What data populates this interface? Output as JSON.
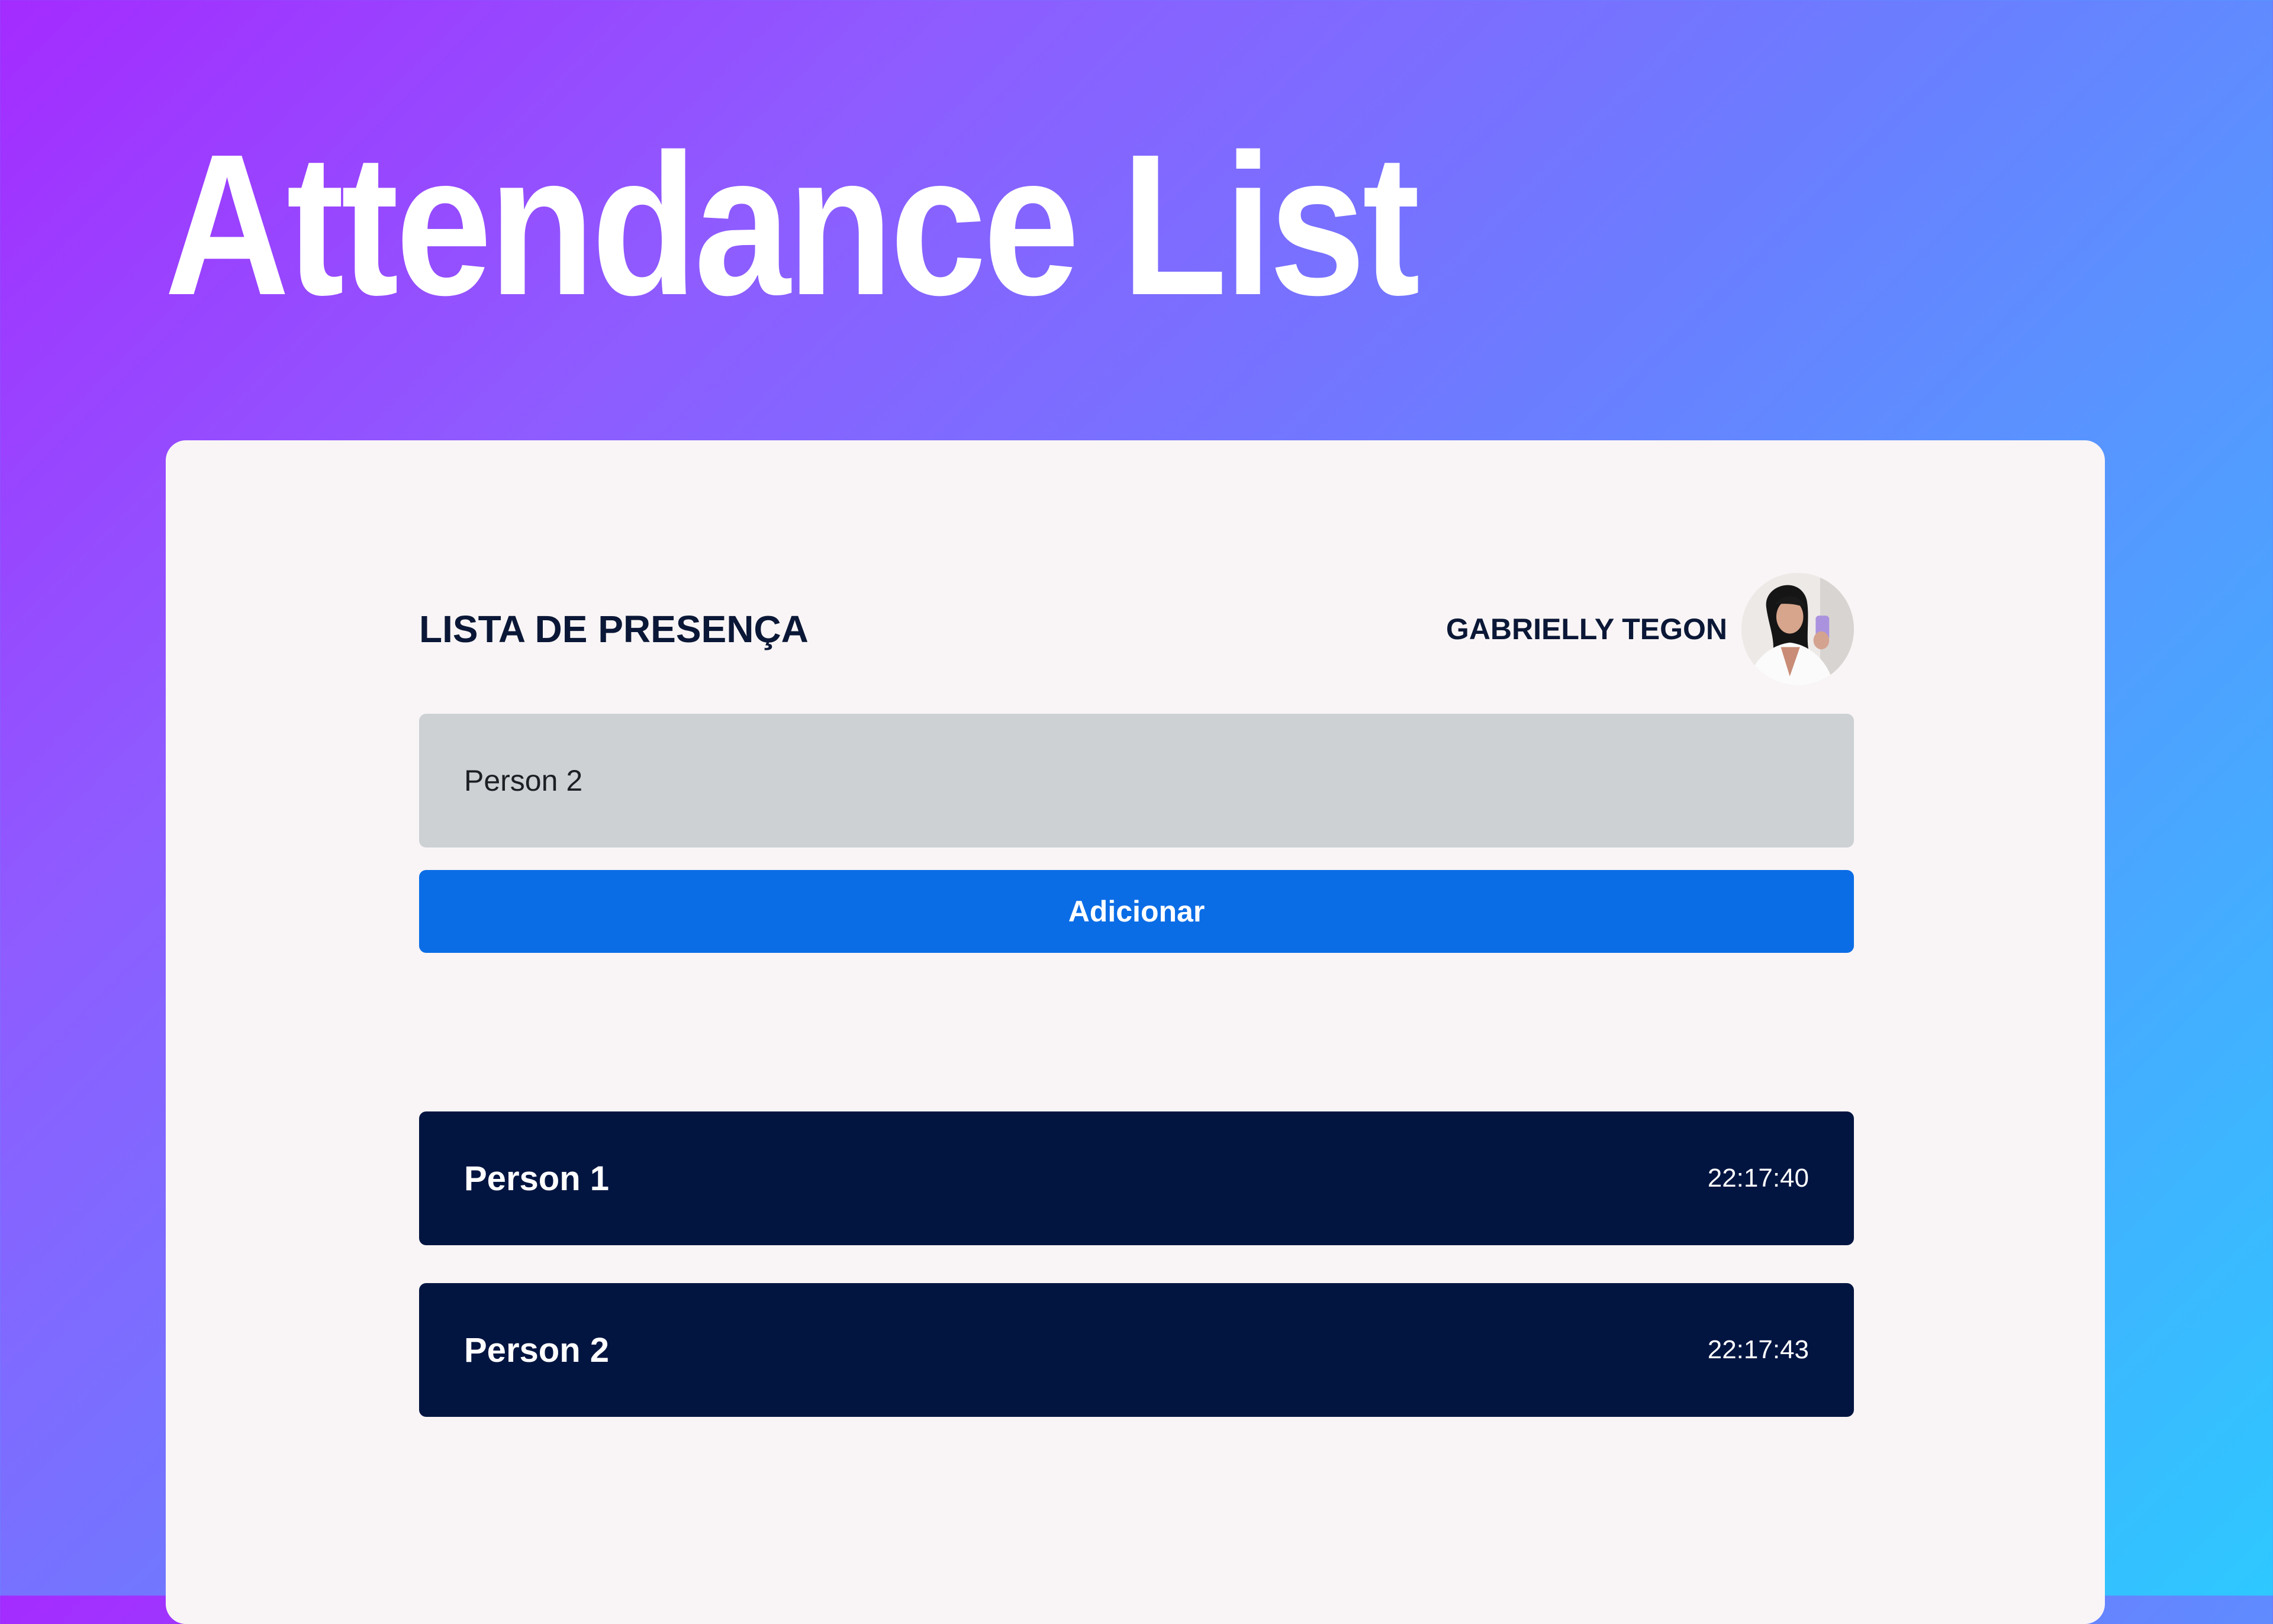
{
  "hero": {
    "title": "Attendance List"
  },
  "card": {
    "list_title": "LISTA DE PRESENÇA",
    "user": {
      "name": "GABRIELLY TEGON",
      "avatar_icon": "user-photo"
    },
    "input": {
      "value": "Person 2",
      "placeholder": ""
    },
    "add_button_label": "Adicionar",
    "attendees": [
      {
        "name": "Person 1",
        "time": "22:17:40"
      },
      {
        "name": "Person 2",
        "time": "22:17:43"
      }
    ]
  },
  "colors": {
    "gradient_start": "#a42bff",
    "gradient_end": "#2ec8ff",
    "card_background": "#f9f5f6",
    "text_dark": "#0b1736",
    "input_background": "#cdd1d4",
    "button_primary": "#0b6de6",
    "row_background": "#021541"
  }
}
